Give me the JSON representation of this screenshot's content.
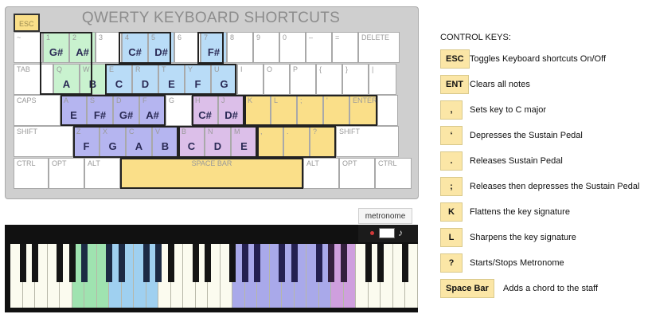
{
  "keyboard": {
    "title": "QWERTY KEYBOARD SHORTCUTS",
    "esc_label": "ESC",
    "rows": [
      [
        {
          "label": "~"
        },
        {
          "label": "1",
          "note": "G#",
          "zone": "green"
        },
        {
          "label": "2",
          "note": "A#",
          "zone": "green"
        },
        {
          "label": "3"
        },
        {
          "label": "4",
          "note": "C#",
          "zone": "blue"
        },
        {
          "label": "5",
          "note": "D#",
          "zone": "blue"
        },
        {
          "label": "6"
        },
        {
          "label": "7",
          "note": "F#",
          "zone": "blue"
        },
        {
          "label": "8"
        },
        {
          "label": "9"
        },
        {
          "label": "0"
        },
        {
          "label": "–"
        },
        {
          "label": "="
        },
        {
          "label": "DELETE"
        }
      ],
      [
        {
          "label": "TAB"
        },
        {
          "label": "Q",
          "note": "A",
          "zone": "green"
        },
        {
          "label": "W",
          "note": "B",
          "zone": "green"
        },
        {
          "label": "E",
          "note": "C",
          "zone": "blue"
        },
        {
          "label": "R",
          "note": "D",
          "zone": "blue"
        },
        {
          "label": "T",
          "note": "E",
          "zone": "blue"
        },
        {
          "label": "Y",
          "note": "F",
          "zone": "blue"
        },
        {
          "label": "U",
          "note": "G",
          "zone": "blue"
        },
        {
          "label": "I"
        },
        {
          "label": "O"
        },
        {
          "label": "P"
        },
        {
          "label": "{"
        },
        {
          "label": "}"
        },
        {
          "label": "|"
        }
      ],
      [
        {
          "label": "CAPS"
        },
        {
          "label": "A",
          "note": "E",
          "zone": "purple"
        },
        {
          "label": "S",
          "note": "F#",
          "zone": "purple"
        },
        {
          "label": "D",
          "note": "G#",
          "zone": "purple"
        },
        {
          "label": "F",
          "note": "A#",
          "zone": "purple"
        },
        {
          "label": "G"
        },
        {
          "label": "H",
          "note": "C#",
          "zone": "mauve"
        },
        {
          "label": "J",
          "note": "D#",
          "zone": "mauve"
        },
        {
          "label": "K",
          "zone": "yellow"
        },
        {
          "label": "L",
          "zone": "yellow"
        },
        {
          "label": ";",
          "zone": "yellow"
        },
        {
          "label": "'",
          "zone": "yellow"
        },
        {
          "label": "ENTER",
          "zone": "yellow"
        },
        {
          "label": ""
        }
      ],
      [
        {
          "label": "SHIFT"
        },
        {
          "label": "Z",
          "note": "F",
          "zone": "purple"
        },
        {
          "label": "X",
          "note": "G",
          "zone": "purple"
        },
        {
          "label": "C",
          "note": "A",
          "zone": "purple"
        },
        {
          "label": "V",
          "note": "B",
          "zone": "purple"
        },
        {
          "label": "B",
          "note": "C",
          "zone": "mauve"
        },
        {
          "label": "N",
          "note": "D",
          "zone": "mauve"
        },
        {
          "label": "M",
          "note": "E",
          "zone": "mauve"
        },
        {
          "label": ",",
          "zone": "yellow"
        },
        {
          "label": ".",
          "zone": "yellow"
        },
        {
          "label": "?",
          "zone": "yellow"
        },
        {
          "label": "SHIFT"
        }
      ],
      [
        {
          "label": "CTRL"
        },
        {
          "label": "OPT"
        },
        {
          "label": "ALT"
        },
        {
          "label": "SPACE BAR",
          "zone": "yellow"
        },
        {
          "label": "ALT"
        },
        {
          "label": "OPT"
        },
        {
          "label": "CTRL"
        }
      ]
    ]
  },
  "controls": {
    "title": "CONTROL KEYS:",
    "items": [
      {
        "key": "ESC",
        "desc": "Toggles Keyboard shortcuts On/Off"
      },
      {
        "key": "ENT",
        "desc": "Clears all notes"
      },
      {
        "key": ",",
        "desc": "Sets key to C major"
      },
      {
        "key": "‘",
        "desc": "Depresses the Sustain Pedal"
      },
      {
        "key": ".",
        "desc": "Releases Sustain Pedal"
      },
      {
        "key": ";",
        "desc": "Releases then depresses the Sustain Pedal"
      },
      {
        "key": "K",
        "desc": "Flattens the key signature"
      },
      {
        "key": "L",
        "desc": "Sharpens the key signature"
      },
      {
        "key": "?",
        "desc": "Starts/Stops Metronome"
      },
      {
        "key": "Space Bar",
        "desc": "Adds a chord to the staff"
      }
    ]
  },
  "metronome": {
    "label": "metronome"
  },
  "colors": {
    "green": "#c9f2cf",
    "blue": "#b9dcf7",
    "purple": "#b5b5f0",
    "mauve": "#dcbfe9",
    "yellow": "#fadf89",
    "piano_green": "#9fe3b0",
    "piano_blue": "#9fd0f0",
    "piano_purple": "#a9a9ea",
    "piano_mauve": "#cf9fde"
  }
}
